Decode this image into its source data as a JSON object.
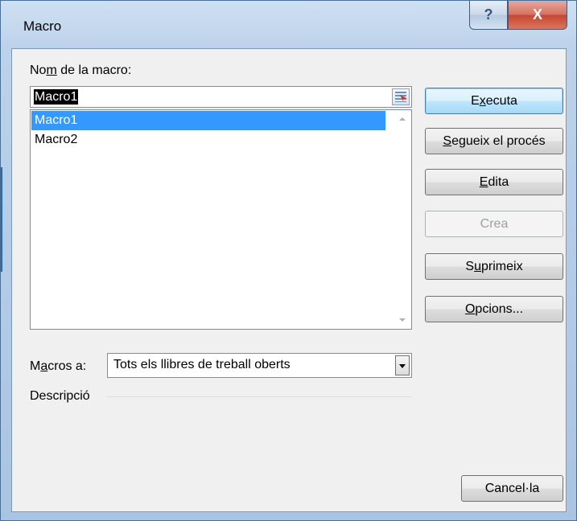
{
  "window": {
    "title": "Macro",
    "help_label": "?",
    "close_label": "X"
  },
  "name_label": {
    "pre": "No",
    "underlined": "m",
    "post": " de la macro:"
  },
  "macro_name_value": "Macro1",
  "macro_list": [
    "Macro1",
    "Macro2"
  ],
  "selected_index": 0,
  "buttons": {
    "run": {
      "pre": "E",
      "underlined": "x",
      "post": "ecuta"
    },
    "step_into": {
      "pre": "",
      "underlined": "S",
      "post": "egueix el procés"
    },
    "edit": {
      "pre": "",
      "underlined": "E",
      "post": "dita"
    },
    "create": "Crea",
    "delete": {
      "pre": "S",
      "underlined": "u",
      "post": "primeix"
    },
    "options": {
      "pre": "",
      "underlined": "O",
      "post": "pcions..."
    },
    "cancel": "Cancel·la"
  },
  "macros_in": {
    "label": {
      "pre": "M",
      "underlined": "a",
      "post": "cros a:"
    },
    "value": "Tots els llibres de treball oberts"
  },
  "description_label": "Descripció",
  "colors": {
    "selection": "#3399ff",
    "frame": "#bcd2ea",
    "close": "#c7452f"
  }
}
